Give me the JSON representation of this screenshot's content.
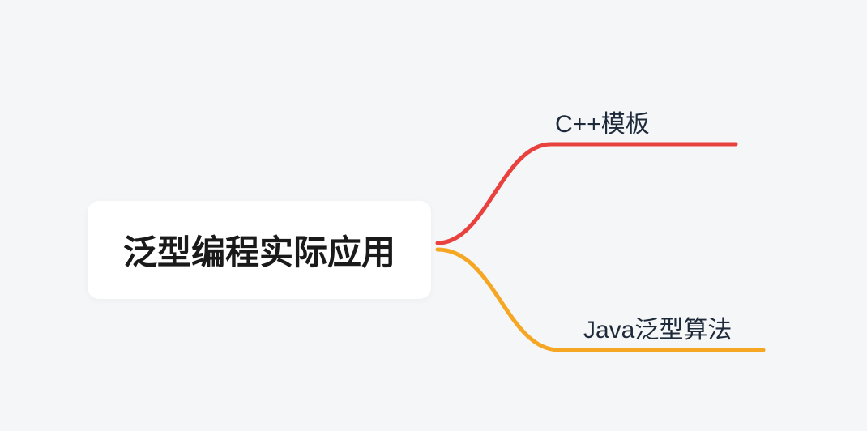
{
  "mindmap": {
    "root": {
      "label": "泛型编程实际应用"
    },
    "branches": [
      {
        "label": "C++模板",
        "color": "#e8413e"
      },
      {
        "label": "Java泛型算法",
        "color": "#f5a623"
      }
    ]
  }
}
